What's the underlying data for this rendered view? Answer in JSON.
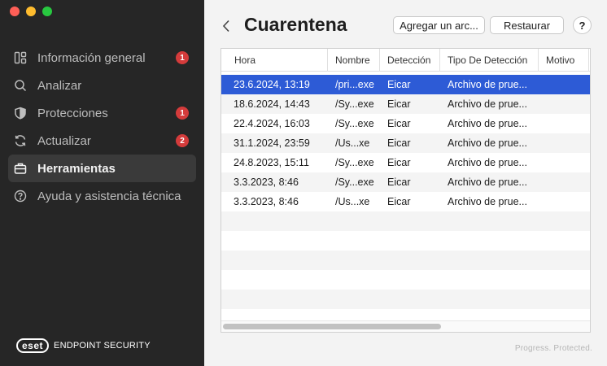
{
  "sidebar": {
    "items": [
      {
        "label": "Información general",
        "icon": "dashboard-icon",
        "badge": "1",
        "active": false
      },
      {
        "label": "Analizar",
        "icon": "search-icon",
        "badge": null,
        "active": false
      },
      {
        "label": "Protecciones",
        "icon": "shield-icon",
        "badge": "1",
        "active": false
      },
      {
        "label": "Actualizar",
        "icon": "refresh-icon",
        "badge": "2",
        "active": false
      },
      {
        "label": "Herramientas",
        "icon": "toolbox-icon",
        "badge": null,
        "active": true
      },
      {
        "label": "Ayuda y asistencia técnica",
        "icon": "help-circle-icon",
        "badge": null,
        "active": false
      }
    ],
    "brand_logo": "eset",
    "brand_text": "ENDPOINT SECURITY"
  },
  "header": {
    "title": "Cuarentena",
    "add_label": "Agregar un arc...",
    "restore_label": "Restaurar",
    "help_label": "?"
  },
  "table": {
    "columns": [
      "Hora",
      "Nombre",
      "Detección",
      "Tipo De Detección",
      "Motivo"
    ],
    "rows": [
      {
        "hora": "23.6.2024, 13:19",
        "nombre": "/pri...exe",
        "deteccion": "Eicar",
        "tipo": "Archivo de prue...",
        "selected": true
      },
      {
        "hora": "18.6.2024, 14:43",
        "nombre": "/Sy...exe",
        "deteccion": "Eicar",
        "tipo": "Archivo de prue...",
        "selected": false
      },
      {
        "hora": "22.4.2024, 16:03",
        "nombre": "/Sy...exe",
        "deteccion": "Eicar",
        "tipo": "Archivo de prue...",
        "selected": false
      },
      {
        "hora": "31.1.2024, 23:59",
        "nombre": "/Us...xe",
        "deteccion": "Eicar",
        "tipo": "Archivo de prue...",
        "selected": false
      },
      {
        "hora": "24.8.2023, 15:11",
        "nombre": "/Sy...exe",
        "deteccion": "Eicar",
        "tipo": "Archivo de prue...",
        "selected": false
      },
      {
        "hora": "3.3.2023, 8:46",
        "nombre": "/Sy...exe",
        "deteccion": "Eicar",
        "tipo": "Archivo de prue...",
        "selected": false
      },
      {
        "hora": "3.3.2023, 8:46",
        "nombre": "/Us...xe",
        "deteccion": "Eicar",
        "tipo": "Archivo de prue...",
        "selected": false
      }
    ]
  },
  "footer": {
    "tagline": "Progress. Protected."
  },
  "colors": {
    "selected_row": "#2d5bd6",
    "badge": "#d43b3b",
    "sidebar_bg": "#262626"
  }
}
